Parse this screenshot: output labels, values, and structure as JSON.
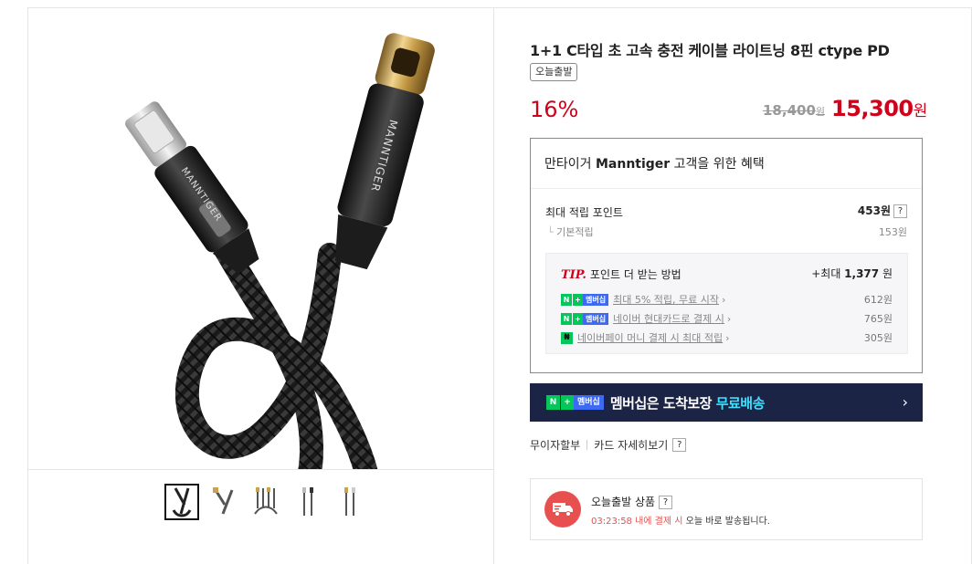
{
  "product": {
    "title": "1+1 C타입 초 고속 충전 케이블 라이트닝 8핀 ctype PD",
    "tag": "오늘출발",
    "discount": "16%",
    "old_price": "18,400",
    "old_price_unit": "원",
    "price": "15,300",
    "price_unit": "원",
    "brand_printed_on_cable": [
      "MANNTIGER",
      "MANNTIGER"
    ],
    "thumbnail_count": 5
  },
  "benefit": {
    "head_prefix": "만타이거 ",
    "head_brand": "Manntiger",
    "head_suffix": " 고객을 위한 혜택",
    "max_point_label": "최대 적립 포인트",
    "max_point_value": "453원",
    "base_label": "기본적립",
    "base_value": "153원",
    "help": "?",
    "tip": {
      "tip_mark": "TIP.",
      "title": "포인트 더 받는 방법",
      "max_prefix": "+최대 ",
      "max_value": "1,377",
      "max_unit": " 원",
      "items": [
        {
          "badge_n": "N",
          "badge_p": "+",
          "badge_m": "멤버십",
          "label": "최대 5% 적립, 무료 시작",
          "value": "612원"
        },
        {
          "badge_n": "N",
          "badge_p": "+",
          "badge_m": "멤버십",
          "label": "네이버 현대카드로 결제 시",
          "value": "765원"
        },
        {
          "badge_single": "₦",
          "label": "네이버페이 머니 결제 시 최대 적립",
          "value": "305원"
        }
      ],
      "chevron": "›"
    }
  },
  "banner": {
    "badge_n": "N",
    "badge_p": "+",
    "badge_m": "멤버십",
    "text": "멤버십은 도착보장 ",
    "accent": "무료배송",
    "arrow": "›"
  },
  "payinfo": {
    "installment": "무이자할부",
    "card_detail": "카드 자세히보기",
    "help": "?"
  },
  "today": {
    "title": "오늘출발 상품",
    "help": "?",
    "countdown": "03:23:58 내에 결제 시",
    "suffix": " 오늘 바로 발송됩니다."
  },
  "colors": {
    "accent_red": "#d0021b",
    "naver_green": "#03c75a",
    "banner_bg": "#1c2446",
    "banner_accent": "#3fe0ff",
    "truck_red": "#e8504f"
  }
}
